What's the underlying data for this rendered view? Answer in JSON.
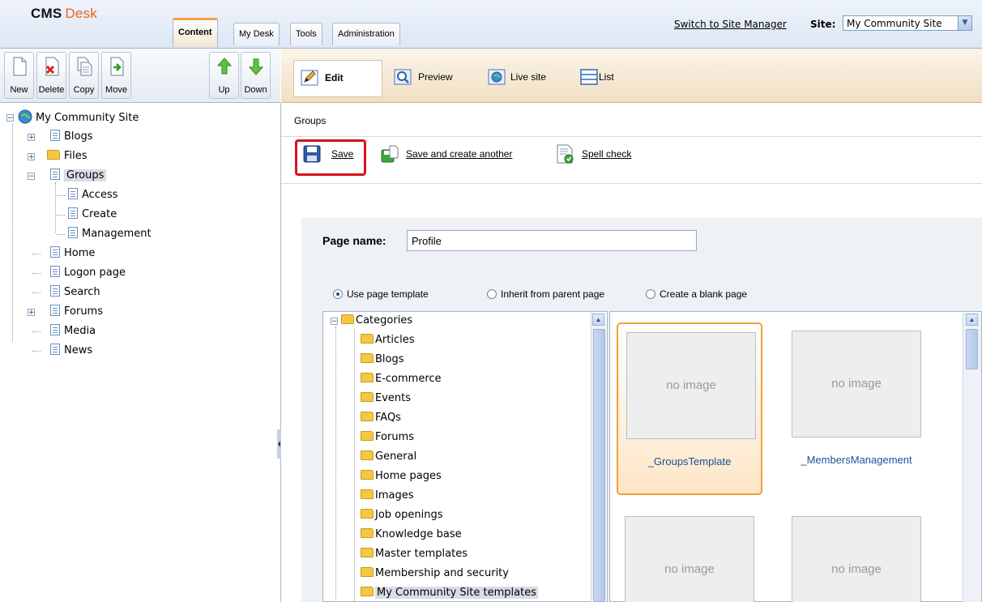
{
  "header": {
    "logo_cms": "CMS",
    "logo_desk": "Desk",
    "tabs": [
      {
        "label": "Content"
      },
      {
        "label": "My Desk"
      },
      {
        "label": "Tools"
      },
      {
        "label": "Administration"
      }
    ],
    "switch_link": "Switch to Site Manager",
    "site_label": "Site:",
    "site_value": "My Community Site"
  },
  "toolbar": {
    "buttons": [
      {
        "label": "New"
      },
      {
        "label": "Delete"
      },
      {
        "label": "Copy"
      },
      {
        "label": "Move"
      },
      {
        "label": "Up"
      },
      {
        "label": "Down"
      }
    ]
  },
  "view_modes": [
    {
      "label": "Edit"
    },
    {
      "label": "Preview"
    },
    {
      "label": "Live site"
    },
    {
      "label": "List"
    }
  ],
  "tree": {
    "root": "My Community Site",
    "items": [
      {
        "label": "Blogs"
      },
      {
        "label": "Files"
      },
      {
        "label": "Groups"
      },
      {
        "label": "Access"
      },
      {
        "label": "Create"
      },
      {
        "label": "Management"
      },
      {
        "label": "Home"
      },
      {
        "label": "Logon page"
      },
      {
        "label": "Search"
      },
      {
        "label": "Forums"
      },
      {
        "label": "Media"
      },
      {
        "label": "News"
      }
    ]
  },
  "breadcrumb": "Groups",
  "actions": {
    "save": "Save",
    "save_another": "Save and create another",
    "spell_check": "Spell check"
  },
  "form": {
    "page_name_label": "Page name:",
    "page_name_value": "Profile",
    "options": [
      {
        "label": "Use page template",
        "selected": true
      },
      {
        "label": "Inherit from parent page",
        "selected": false
      },
      {
        "label": "Create a blank page",
        "selected": false
      }
    ]
  },
  "categories": {
    "root": "Categories",
    "items": [
      {
        "label": "Articles"
      },
      {
        "label": "Blogs"
      },
      {
        "label": "E-commerce"
      },
      {
        "label": "Events"
      },
      {
        "label": "FAQs"
      },
      {
        "label": "Forums"
      },
      {
        "label": "General"
      },
      {
        "label": "Home pages"
      },
      {
        "label": "Images"
      },
      {
        "label": "Job openings"
      },
      {
        "label": "Knowledge base"
      },
      {
        "label": "Master templates"
      },
      {
        "label": "Membership and security"
      },
      {
        "label": "My Community Site templates"
      }
    ]
  },
  "templates": [
    {
      "name": "_GroupsTemplate",
      "image_text": "no image",
      "selected": true
    },
    {
      "name": "_MembersManagement",
      "image_text": "no image",
      "selected": false
    },
    {
      "name": "",
      "image_text": "no image",
      "selected": false
    },
    {
      "name": "",
      "image_text": "no image",
      "selected": false
    }
  ],
  "colors": {
    "accent_orange": "#f0a13a",
    "highlight_red": "#d6131b",
    "link_blue": "#1f4f98"
  }
}
